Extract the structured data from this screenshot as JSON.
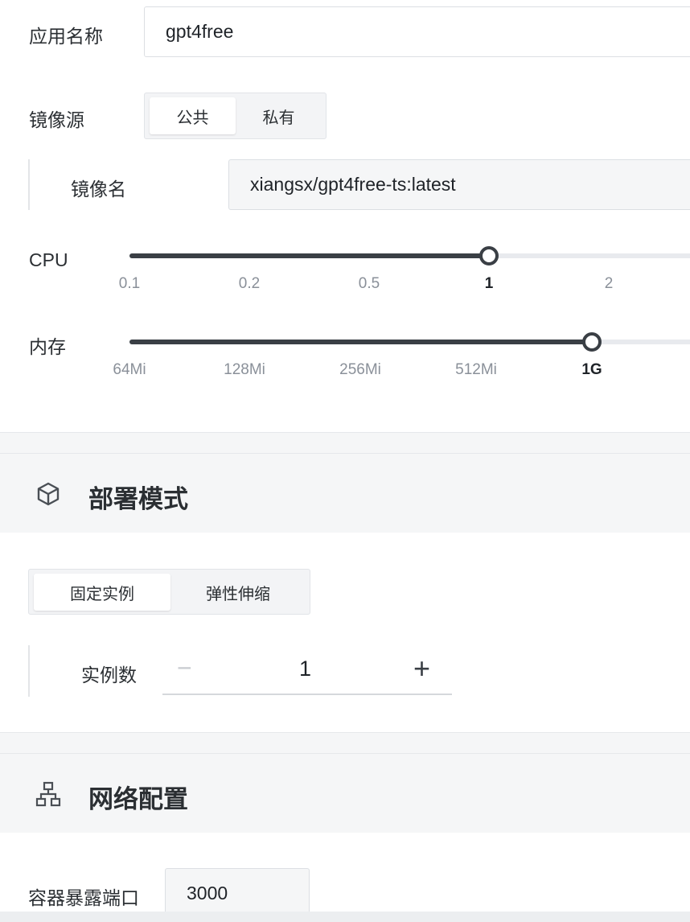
{
  "app_name": {
    "label": "应用名称",
    "value": "gpt4free"
  },
  "image_source": {
    "label": "镜像源",
    "options": [
      "公共",
      "私有"
    ],
    "selected": "公共"
  },
  "image_name": {
    "label": "镜像名",
    "value": "xiangsx/gpt4free-ts:latest"
  },
  "cpu": {
    "label": "CPU",
    "ticks": [
      "0.1",
      "0.2",
      "0.5",
      "1",
      "2"
    ],
    "selected": "1"
  },
  "memory": {
    "label": "内存",
    "ticks": [
      "64Mi",
      "128Mi",
      "256Mi",
      "512Mi",
      "1G"
    ],
    "selected": "1G"
  },
  "deploy": {
    "title": "部署模式",
    "icon": "cube-icon",
    "modes": [
      "固定实例",
      "弹性伸缩"
    ],
    "selected": "固定实例",
    "instances_label": "实例数",
    "instances_value": "1",
    "minus": "−",
    "plus": "+"
  },
  "network": {
    "title": "网络配置",
    "icon": "network-icon",
    "port_label": "容器暴露端口",
    "port_value": "3000"
  },
  "colors": {
    "accent": "#3a3f45",
    "section_bg": "#f5f6f7",
    "border": "#dcdfe3"
  }
}
